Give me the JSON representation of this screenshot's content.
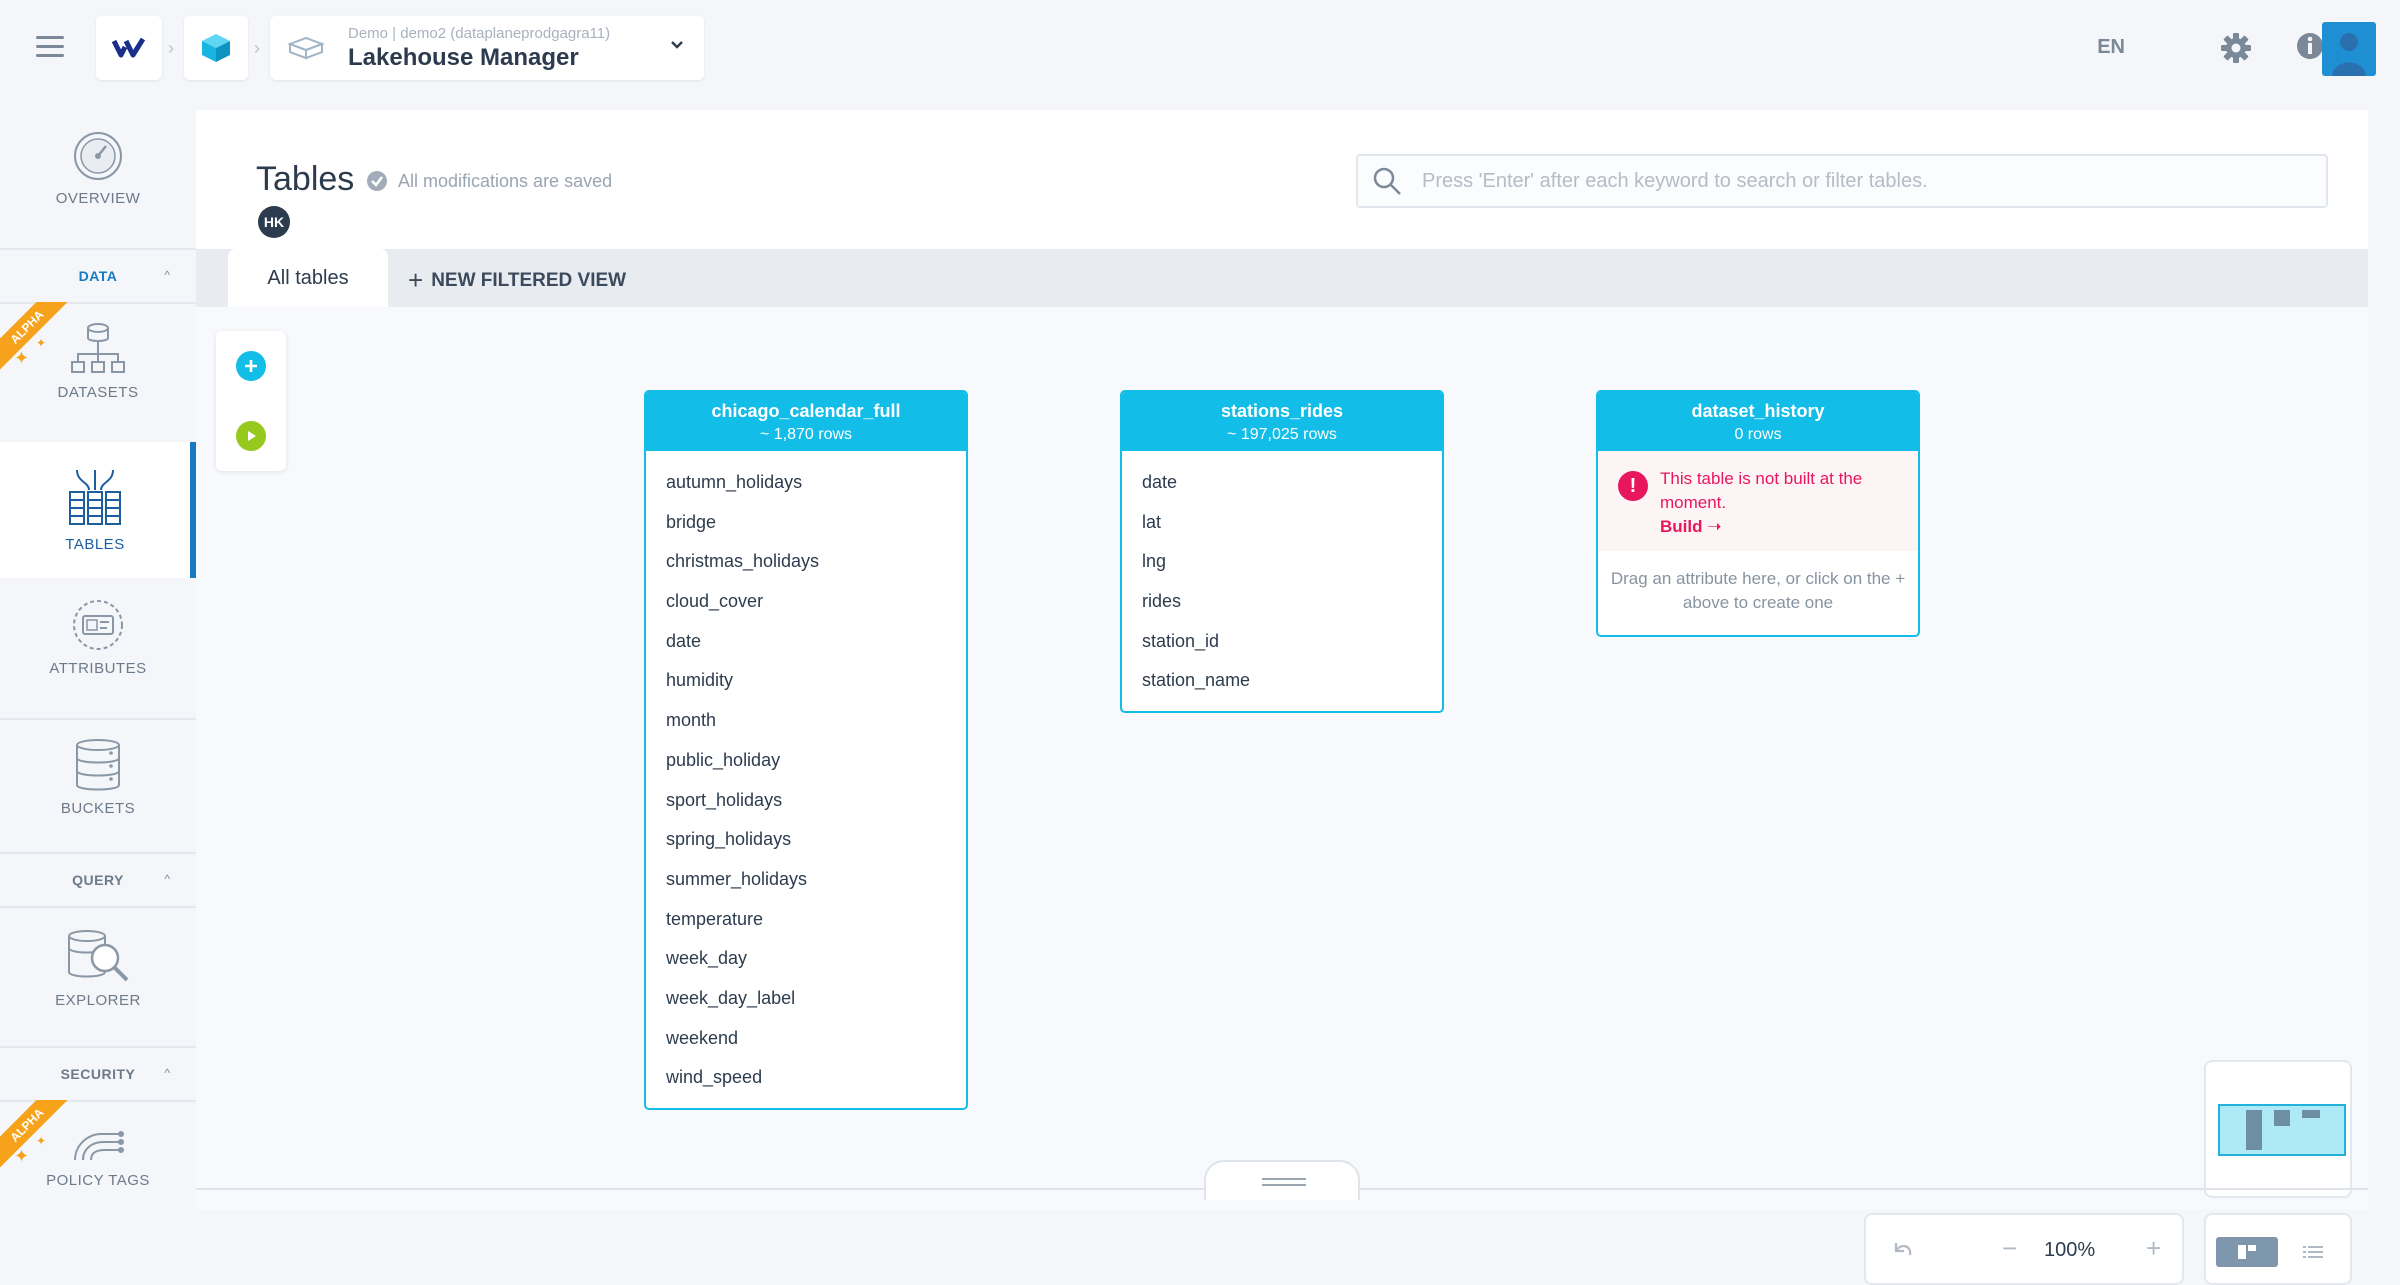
{
  "header": {
    "app_subtitle": "Demo | demo2 (dataplaneprodgagra11)",
    "app_title": "Lakehouse Manager",
    "language": "EN"
  },
  "sidebar": {
    "overview": "OVERVIEW",
    "data_section": "DATA",
    "datasets": "DATASETS",
    "tables": "TABLES",
    "attributes": "ATTRIBUTES",
    "buckets": "BUCKETS",
    "query_section": "QUERY",
    "explorer": "EXPLORER",
    "security_section": "SECURITY",
    "policy_tags": "POLICY TAGS",
    "alpha_label": "ALPHA"
  },
  "page": {
    "title": "Tables",
    "saved_status": "All modifications are saved",
    "user_initials": "HK",
    "search_placeholder": "Press 'Enter' after each keyword to search or filter tables.",
    "tab_all": "All tables",
    "tab_new": "NEW FILTERED VIEW"
  },
  "tables": [
    {
      "name": "chicago_calendar_full",
      "rows": "~ 1,870 rows",
      "columns": [
        "autumn_holidays",
        "bridge",
        "christmas_holidays",
        "cloud_cover",
        "date",
        "humidity",
        "month",
        "public_holiday",
        "sport_holidays",
        "spring_holidays",
        "summer_holidays",
        "temperature",
        "week_day",
        "week_day_label",
        "weekend",
        "wind_speed"
      ]
    },
    {
      "name": "stations_rides",
      "rows": "~ 197,025 rows",
      "columns": [
        "date",
        "lat",
        "lng",
        "rides",
        "station_id",
        "station_name"
      ]
    },
    {
      "name": "dataset_history",
      "rows": "0 rows",
      "warning": "This table is not built at the moment.",
      "build_label": "Build",
      "drop_hint": "Drag an attribute here, or click on the + above to create one"
    }
  ],
  "zoom": {
    "level": "100%"
  },
  "colors": {
    "accent": "#12bde8",
    "nav_active": "#1979c3",
    "error": "#e8175d",
    "alpha": "#f7a21b"
  }
}
